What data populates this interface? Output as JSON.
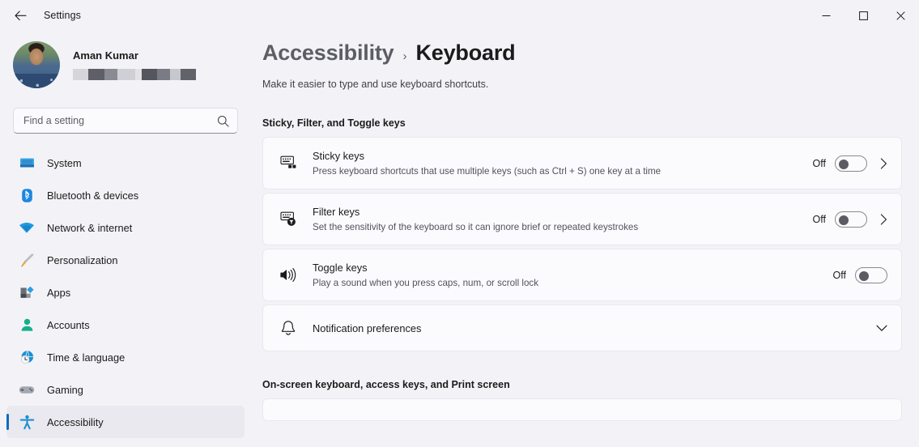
{
  "titlebar": {
    "back_label": "back-arrow",
    "title": "Settings",
    "minimize": "minimize",
    "maximize": "maximize",
    "close": "close"
  },
  "sidebar": {
    "profile": {
      "name": "Aman Kumar",
      "email_redacted": true
    },
    "search": {
      "placeholder": "Find a setting",
      "value": ""
    },
    "items": [
      {
        "label": "System",
        "icon": "monitor-icon",
        "active": false
      },
      {
        "label": "Bluetooth & devices",
        "icon": "bluetooth-icon",
        "active": false
      },
      {
        "label": "Network & internet",
        "icon": "wifi-icon",
        "active": false
      },
      {
        "label": "Personalization",
        "icon": "brush-icon",
        "active": false
      },
      {
        "label": "Apps",
        "icon": "apps-icon",
        "active": false
      },
      {
        "label": "Accounts",
        "icon": "person-icon",
        "active": false
      },
      {
        "label": "Time & language",
        "icon": "globe-clock-icon",
        "active": false
      },
      {
        "label": "Gaming",
        "icon": "gamepad-icon",
        "active": false
      },
      {
        "label": "Accessibility",
        "icon": "accessibility-icon",
        "active": true
      }
    ]
  },
  "main": {
    "breadcrumb": {
      "parent": "Accessibility",
      "separator": "›",
      "current": "Keyboard"
    },
    "description": "Make it easier to type and use keyboard shortcuts.",
    "sections": [
      {
        "heading": "Sticky, Filter, and Toggle keys",
        "rows": [
          {
            "title": "Sticky keys",
            "subtitle": "Press keyboard shortcuts that use multiple keys (such as Ctrl + S) one key at a time",
            "icon": "sticky-keys-icon",
            "toggle_state": "Off",
            "toggle_on": false,
            "chevron": "right"
          },
          {
            "title": "Filter keys",
            "subtitle": "Set the sensitivity of the keyboard so it can ignore brief or repeated keystrokes",
            "icon": "filter-keys-icon",
            "toggle_state": "Off",
            "toggle_on": false,
            "chevron": "right"
          },
          {
            "title": "Toggle keys",
            "subtitle": "Play a sound when you press caps, num, or scroll lock",
            "icon": "speaker-icon",
            "toggle_state": "Off",
            "toggle_on": false,
            "chevron": "none"
          },
          {
            "title": "Notification preferences",
            "subtitle": "",
            "icon": "bell-icon",
            "toggle_state": "",
            "toggle_on": false,
            "chevron": "down"
          }
        ]
      },
      {
        "heading": "On-screen keyboard, access keys, and Print screen",
        "rows": []
      }
    ]
  },
  "colors": {
    "page_background": "#f3f3f7",
    "card_background": "#fbfbfd",
    "accent": "#0f6cbd",
    "text_primary": "#1b1b1b",
    "text_secondary": "#52525b"
  }
}
